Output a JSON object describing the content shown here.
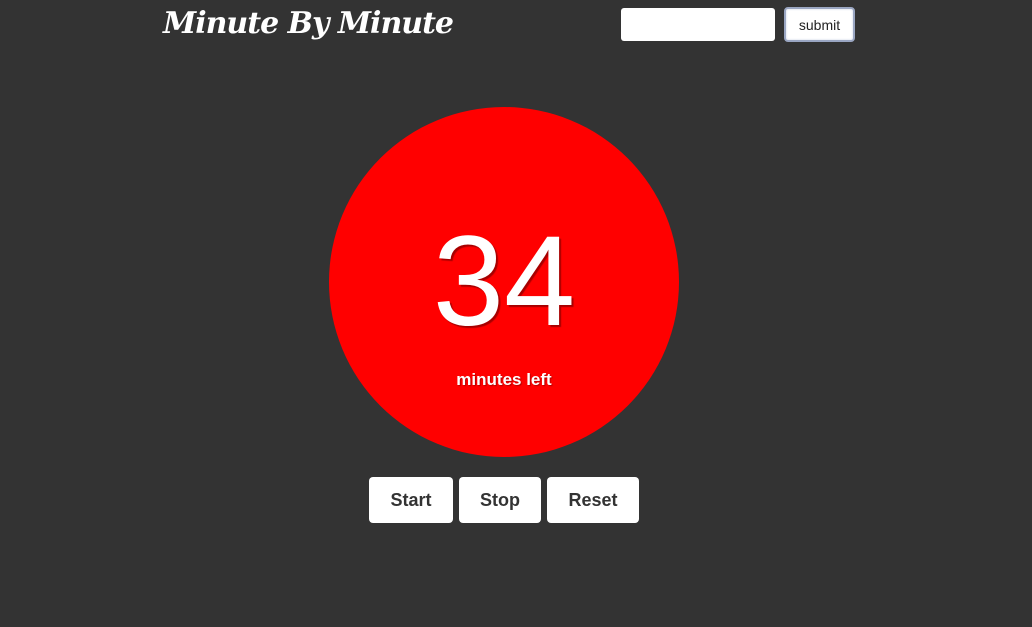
{
  "header": {
    "brand": "Minute By Minute",
    "input_value": "",
    "submit_label": "submit"
  },
  "timer": {
    "count": "34",
    "label": "minutes left",
    "circle_color": "#ff0000",
    "background_color": "#333333"
  },
  "controls": {
    "start_label": "Start",
    "stop_label": "Stop",
    "reset_label": "Reset"
  }
}
